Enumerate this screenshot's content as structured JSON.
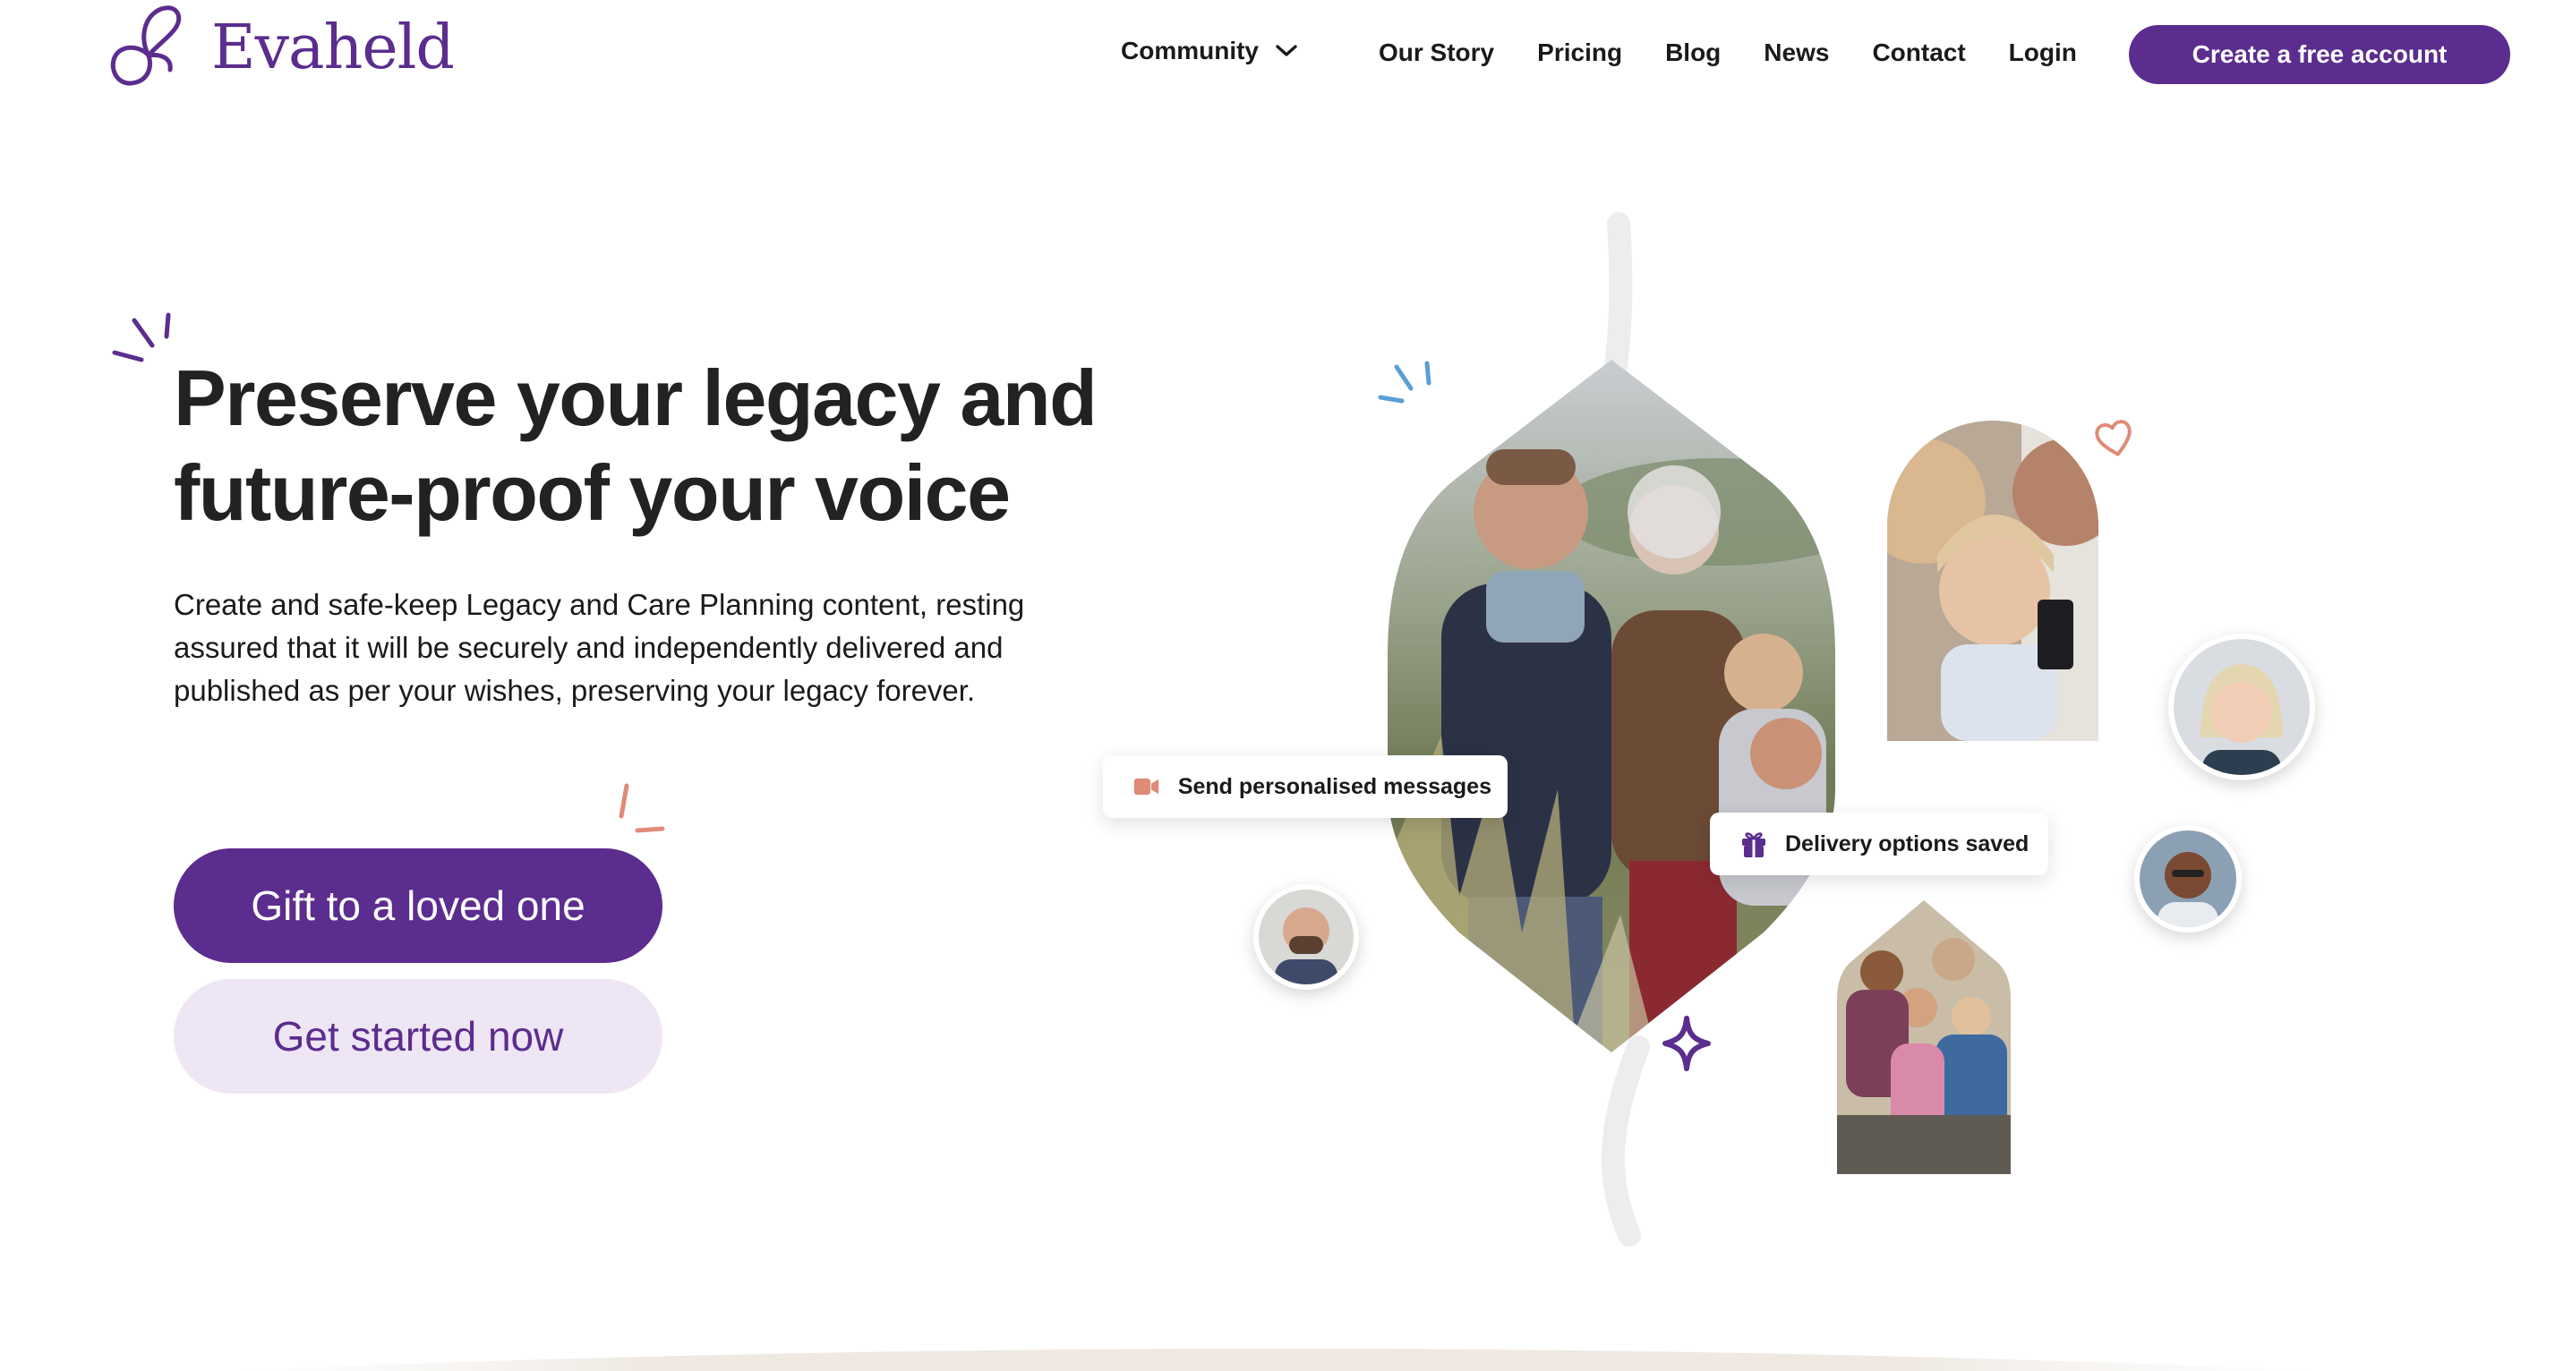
{
  "brand": {
    "name": "Evaheld",
    "color": "#5b2d8e"
  },
  "nav": {
    "items": [
      {
        "label": "Community",
        "has_dropdown": true
      },
      {
        "label": "Our Story"
      },
      {
        "label": "Pricing"
      },
      {
        "label": "Blog"
      },
      {
        "label": "News"
      },
      {
        "label": "Contact"
      },
      {
        "label": "Login"
      }
    ],
    "cta_label": "Create a free account"
  },
  "hero": {
    "title_line1": "Preserve your legacy and",
    "title_line2": "future-proof your voice",
    "subtitle": "Create and safe-keep Legacy and Care Planning content, resting assured that it will be securely and independently delivered and published as per your wishes, preserving your legacy forever.",
    "primary_button": "Gift to a loved one",
    "secondary_button": "Get started now"
  },
  "badges": {
    "messages": {
      "label": "Send personalised messages",
      "icon": "video-camera-icon"
    },
    "delivery": {
      "label": "Delivery options saved",
      "icon": "gift-icon"
    }
  },
  "colors": {
    "primary": "#5b2d8e",
    "secondary_bg": "#eee6f4",
    "accent_coral": "#e08a78",
    "accent_blue": "#5a9fd4"
  }
}
